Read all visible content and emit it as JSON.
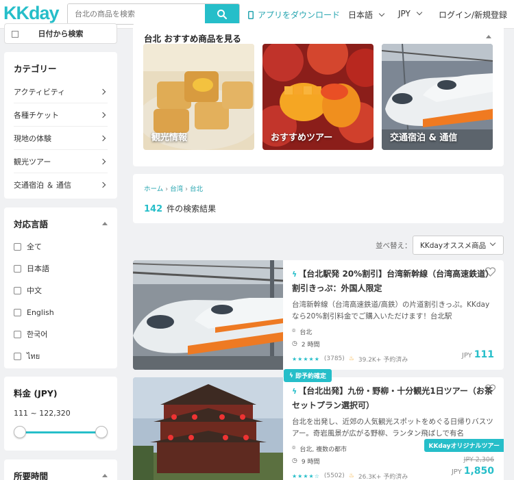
{
  "header": {
    "logo": "KKday",
    "search_placeholder": "台北の商品を検索",
    "app_download": "アプリをダウンロード",
    "language": "日本語",
    "currency": "JPY",
    "login": "ログイン/新規登録"
  },
  "sidebar": {
    "date_search": "日付から検索",
    "category_title": "カテゴリー",
    "categories": [
      {
        "label": "アクティビティ"
      },
      {
        "label": "各種チケット"
      },
      {
        "label": "現地の体験"
      },
      {
        "label": "観光ツアー"
      },
      {
        "label": "交通宿泊 ＆ 通信"
      }
    ],
    "language_title": "対応言語",
    "languages": [
      {
        "label": "全て"
      },
      {
        "label": "日本語"
      },
      {
        "label": "中文"
      },
      {
        "label": "English"
      },
      {
        "label": "한국어"
      },
      {
        "label": "ไทย"
      }
    ],
    "price_title": "料金 (JPY)",
    "price_range": "111 ~ 122,320",
    "duration_title": "所要時間"
  },
  "recommend": {
    "title": "台北 おすすめ商品を見る",
    "tiles": [
      {
        "label": "観光情報"
      },
      {
        "label": "おすすめツアー"
      },
      {
        "label": "交通宿泊 & 通信"
      }
    ]
  },
  "results": {
    "breadcrumb": [
      "ホーム",
      "台湾",
      "台北"
    ],
    "count": "142",
    "count_suffix": "件の検索結果",
    "sort_label": "並べ替え：",
    "sort_value": "KKdayオススメ商品"
  },
  "products": [
    {
      "title": "【台北駅発 20%割引】台湾新幹線（台湾高速鉄道）割引きっぷ：外国人限定",
      "desc": "台湾新幹線（台湾高速鉄道/高鉄）の片道割引きっぷ。KKdayなら20%割引料金でご購入いただけます！台北駅",
      "location": "台北",
      "duration": "2 時間",
      "rating": 5,
      "reviews": "(3785)",
      "booked": "39.2K+ 予約済み",
      "currency": "JPY",
      "price": "111"
    },
    {
      "badge": "即予約確定",
      "title": "【台北出発】九份・野柳・十分観光1日ツアー（お茶セットプラン選択可）",
      "desc": "台北を出発し、近郊の人気観光スポットをめぐる日帰りバスツアー。奇岩風景が広がる野柳、ランタン飛ばしで有名",
      "location": "台北, 複数の都市",
      "duration": "9 時間",
      "rating": 4.5,
      "reviews": "(5502)",
      "booked": "26.3K+ 予約済み",
      "original_badge": "KKdayオリジナルツアー",
      "old_price": "JPY 2,306",
      "currency": "JPY",
      "price": "1,850"
    }
  ],
  "colors": {
    "accent": "#26bec9"
  }
}
